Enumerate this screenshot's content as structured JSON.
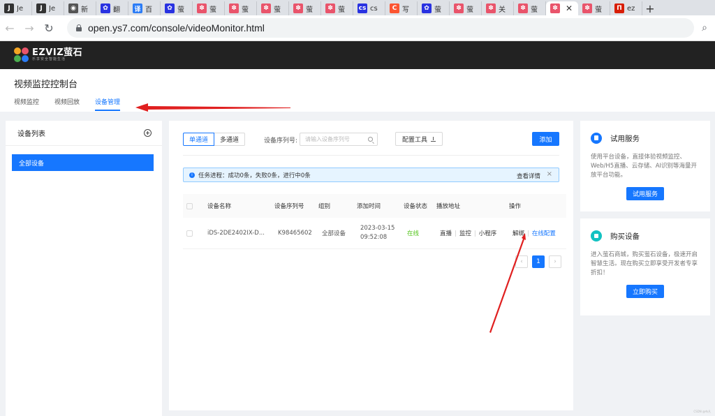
{
  "browser": {
    "tabs": [
      {
        "icon": "J",
        "label": "Je",
        "color": "#333"
      },
      {
        "icon": "J",
        "label": "Je",
        "color": "#333"
      },
      {
        "icon": "◉",
        "label": "新",
        "color": "#555"
      },
      {
        "icon": "✿",
        "label": "翻",
        "color": "#2932e1"
      },
      {
        "icon": "译",
        "label": "百",
        "color": "#2b7cf6"
      },
      {
        "icon": "✿",
        "label": "萤",
        "color": "#2932e1"
      },
      {
        "icon": "✽",
        "label": "萤",
        "color": "#e9546b"
      },
      {
        "icon": "✽",
        "label": "萤",
        "color": "#e9546b"
      },
      {
        "icon": "✽",
        "label": "萤",
        "color": "#e9546b"
      },
      {
        "icon": "✽",
        "label": "萤",
        "color": "#e9546b"
      },
      {
        "icon": "✽",
        "label": "萤",
        "color": "#e9546b"
      },
      {
        "icon": "cs",
        "label": "cs",
        "color": "#2932e1"
      },
      {
        "icon": "C",
        "label": "写",
        "color": "#fc5531"
      },
      {
        "icon": "✿",
        "label": "萤",
        "color": "#2932e1"
      },
      {
        "icon": "✽",
        "label": "萤",
        "color": "#e9546b"
      },
      {
        "icon": "✽",
        "label": "关",
        "color": "#e9546b"
      },
      {
        "icon": "✽",
        "label": "萤",
        "color": "#e9546b"
      }
    ],
    "active_tab": {
      "icon": "✽",
      "color": "#e9546b",
      "close": "✕"
    },
    "after_tabs": [
      {
        "icon": "✽",
        "label": "萤",
        "color": "#e9546b"
      },
      {
        "icon": "П",
        "label": "ez",
        "color": "#d81e06"
      }
    ],
    "new_tab": "+",
    "url": "open.ys7.com/console/videoMonitor.html"
  },
  "site": {
    "brand": "EZVIZ萤石",
    "slogan": "乐享安全智能生活"
  },
  "console": {
    "title": "视频监控控制台",
    "tabs": [
      "视频监控",
      "视频回放",
      "设备管理"
    ],
    "active_tab_index": 2
  },
  "device_list": {
    "title": "设备列表",
    "all_devices": "全部设备"
  },
  "toolbar": {
    "single_channel": "单通道",
    "multi_channel": "多通道",
    "serial_label": "设备序列号:",
    "serial_placeholder": "请输入设备序列号",
    "config_tool": "配置工具",
    "add": "添加"
  },
  "alert": {
    "text": "任务进程：成功0条，失败0条，进行中0条",
    "detail": "查看详情",
    "close": "×"
  },
  "table": {
    "headers": [
      "设备名称",
      "设备序列号",
      "组别",
      "添加时间",
      "设备状态",
      "播放地址",
      "操作"
    ],
    "rows": [
      {
        "name": "iDS-2DE2402IX-D...",
        "serial": "K98465602",
        "group": "全部设备",
        "date": "2023-03-15",
        "time": "09:52:08",
        "status": "在线",
        "play_live": "直播",
        "play_monitor": "监控",
        "play_mini": "小程序",
        "op_unbind": "解绑",
        "op_config": "在线配置"
      }
    ]
  },
  "pagination": {
    "prev": "‹",
    "current": "1",
    "next": "›"
  },
  "cards": [
    {
      "title": "试用服务",
      "desc": "使用平台设备，直接体验视频监控、Web/H5直播、云存储、AI识别等海量开放平台功能。",
      "button": "试用服务"
    },
    {
      "title": "购买设备",
      "desc": "进入萤石商城，购买萤石设备，极速开启智慧生活。现在购买立即享受开发者专享折扣！",
      "button": "立即购买"
    }
  ],
  "watermark": "CSDN @布凡",
  "colors": {
    "accent": "#1677ff",
    "online": "#52c41a",
    "annotation": "#e02020"
  }
}
